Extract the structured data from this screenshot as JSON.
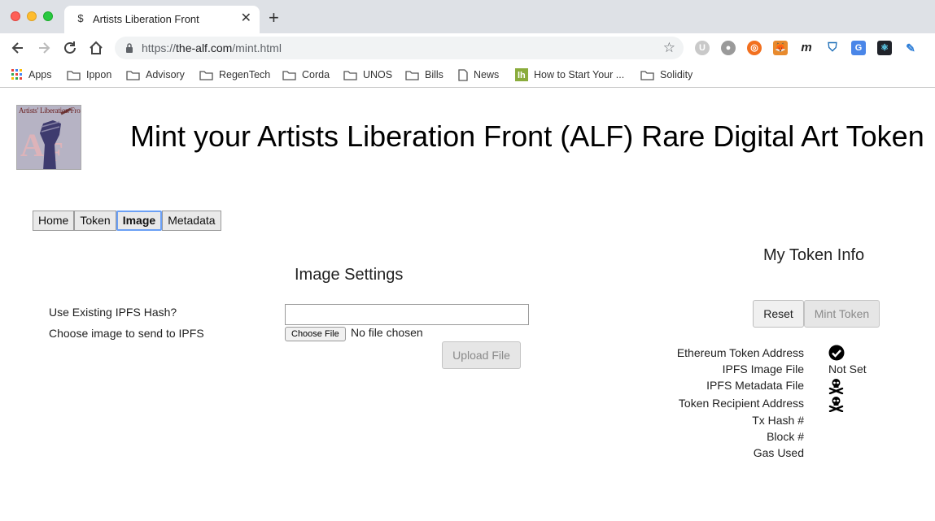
{
  "browser": {
    "tab_title": "Artists Liberation Front",
    "tab_favicon": "alf-favicon",
    "url_scheme": "https://",
    "url_host": "the-alf.com",
    "url_path": "/mint.html",
    "bookmarks": [
      "Apps",
      "Ippon",
      "Advisory",
      "RegenTech",
      "Corda",
      "UNOS",
      "Bills",
      "News",
      "How to Start Your ...",
      "Solidity"
    ]
  },
  "page": {
    "logo_text": "Artists' Liberation Front",
    "logo_letters": "ALF",
    "title": "Mint your Artists Liberation Front (ALF) Rare Digital Art Token"
  },
  "tabs": [
    {
      "label": "Home",
      "active": false
    },
    {
      "label": "Token",
      "active": false
    },
    {
      "label": "Image",
      "active": true
    },
    {
      "label": "Metadata",
      "active": false
    }
  ],
  "image_settings": {
    "title": "Image Settings",
    "existing_hash_label": "Use Existing IPFS Hash?",
    "existing_hash_value": "",
    "choose_image_label": "Choose image to send to IPFS",
    "choose_file_button": "Choose File",
    "no_file_text": "No file chosen",
    "upload_button": "Upload File"
  },
  "token_info": {
    "title": "My Token Info",
    "reset_button": "Reset",
    "mint_button": "Mint Token",
    "rows": [
      {
        "label": "Ethereum Token Address",
        "value": "",
        "icon": "check-circle-icon"
      },
      {
        "label": "IPFS Image File",
        "value": "Not Set",
        "icon": ""
      },
      {
        "label": "IPFS Metadata File",
        "value": "",
        "icon": "skull-crossbones-icon"
      },
      {
        "label": "Token Recipient Address",
        "value": "",
        "icon": "skull-crossbones-icon"
      },
      {
        "label": "Tx Hash #",
        "value": "",
        "icon": ""
      },
      {
        "label": "Block #",
        "value": "",
        "icon": ""
      },
      {
        "label": "Gas Used",
        "value": "",
        "icon": ""
      }
    ]
  },
  "colors": {
    "tabstrip_bg": "#dee1e6",
    "active_tab_border": "#6a9ff5",
    "disabled_button_bg": "#e6e6e6"
  }
}
